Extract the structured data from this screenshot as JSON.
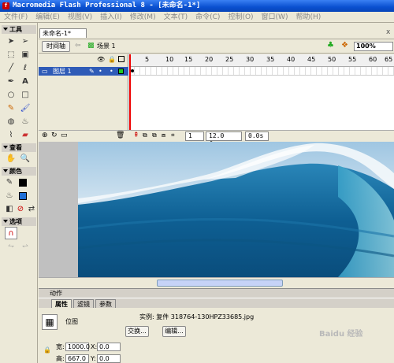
{
  "window": {
    "title": "Macromedia Flash Professional 8 - [未命名-1*]"
  },
  "menu": [
    "文件(F)",
    "编辑(E)",
    "视图(V)",
    "插入(I)",
    "修改(M)",
    "文本(T)",
    "命令(C)",
    "控制(O)",
    "窗口(W)",
    "帮助(H)"
  ],
  "tools": {
    "section_tools": "工具",
    "section_view": "查看",
    "section_colors": "颜色",
    "section_options": "选项"
  },
  "document": {
    "tab_label": "未命名-1*",
    "close_glyph": "x"
  },
  "timeline_toolbar": {
    "timeline_button": "时间轴",
    "scene_label": "场景 1",
    "zoom_value": "100%"
  },
  "timeline": {
    "frame_numbers": [
      "5",
      "10",
      "15",
      "20",
      "25",
      "30",
      "35",
      "40",
      "45",
      "50",
      "55",
      "60",
      "65"
    ],
    "layer_name": "图层 1",
    "current_frame": "1",
    "frame_rate": "12.0 fps",
    "elapsed": "0.0s"
  },
  "panels": {
    "actions_label": "动作",
    "tabs": [
      "属性",
      "滤镜",
      "参数"
    ]
  },
  "properties": {
    "type_label": "位图",
    "instance_text": "实例: 复件 318764-130HPZ33685.jpg",
    "swap_button": "交换...",
    "edit_button": "编辑...",
    "width_label": "宽:",
    "width_value": "1000.0",
    "height_label": "高:",
    "height_value": "667.0",
    "x_label": "X:",
    "x_value": "0.0",
    "y_label": "Y:",
    "y_value": "0.0"
  },
  "watermark": "Baidu 经验",
  "colors": {
    "titlebar": "#0a50d0",
    "layer_selected": "#2f5bb7",
    "playhead": "#e00000",
    "stroke_color": "#000000",
    "fill_color": "#1f6fd6"
  }
}
